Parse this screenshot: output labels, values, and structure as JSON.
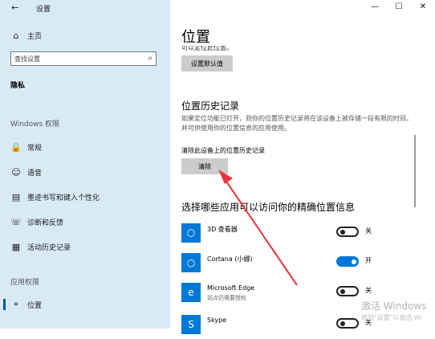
{
  "sidebar": {
    "app_title": "设置",
    "home_label": "主页",
    "search_placeholder": "查找设置",
    "section_privacy": "隐私",
    "group_windows": "Windows 权限",
    "items": [
      {
        "label": "常规",
        "icon": "lock-icon"
      },
      {
        "label": "语音",
        "icon": "speech-icon"
      },
      {
        "label": "墨迹书写和键入个性化",
        "icon": "pen-icon"
      },
      {
        "label": "诊断和反馈",
        "icon": "feedback-icon"
      },
      {
        "label": "活动历史记录",
        "icon": "history-icon"
      }
    ],
    "group_app": "应用权限",
    "location_label": "位置"
  },
  "window_controls": {
    "minimize": "—",
    "maximize": "☐",
    "close": "✕"
  },
  "main": {
    "title": "位置",
    "cut_text": "可以定位此位置。",
    "default_button": "设置默认值",
    "history_title": "位置历史记录",
    "history_desc": "如果定位功能已打开，则你的位置历史记录将在该设备上被存储一段有限的时间，并可供使用你的位置信息的应用使用。",
    "clear_heading": "清除此设备上的位置历史记录",
    "clear_button": "清除",
    "apps_heading": "选择哪些应用可以访问你的精确位置信息",
    "apps": [
      {
        "name": "3D 查看器",
        "sub": "",
        "state": "关",
        "on": false,
        "icon": "cube-icon"
      },
      {
        "name": "Cortana (小娜)",
        "sub": "",
        "state": "开",
        "on": true,
        "icon": "cortana-icon"
      },
      {
        "name": "Microsoft Edge",
        "sub": "站点仍需要授权",
        "state": "关",
        "on": false,
        "icon": "edge-icon"
      },
      {
        "name": "Skype",
        "sub": "",
        "state": "关",
        "on": false,
        "icon": "skype-icon"
      }
    ]
  },
  "watermark": {
    "line1": "激活 Windows",
    "line2": "转到\"设置\"以激活 Wi"
  },
  "colors": {
    "sidebar_bg": "#d9eaf7",
    "accent": "#0078d7",
    "arrow": "#e8353b"
  }
}
